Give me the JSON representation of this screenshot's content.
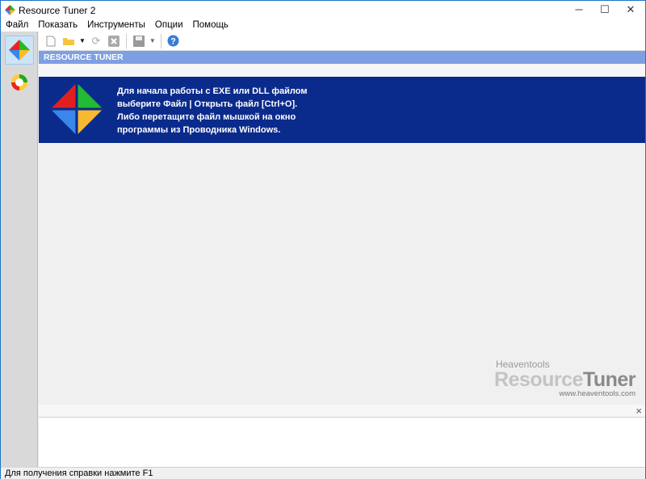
{
  "window": {
    "title": "Resource Tuner 2",
    "minimize": "─",
    "maximize": "☐",
    "close": "✕"
  },
  "menu": [
    "Файл",
    "Показать",
    "Инструменты",
    "Опции",
    "Помощь"
  ],
  "header": {
    "title": "RESOURCE TUNER"
  },
  "banner": {
    "lines": [
      "Для начала работы с EXE или DLL файлом",
      "выберите Файл | Открыть файл [Ctrl+O].",
      "Либо перетащите файл мышкой на окно",
      "программы из Проводника Windows."
    ]
  },
  "brand": {
    "company": "Heaventools",
    "product_a": "Resource",
    "product_b": "Tuner",
    "url": "www.heaventools.com"
  },
  "panel": {
    "close": "×"
  },
  "status": {
    "text": "Для получения справки нажмите F1"
  }
}
